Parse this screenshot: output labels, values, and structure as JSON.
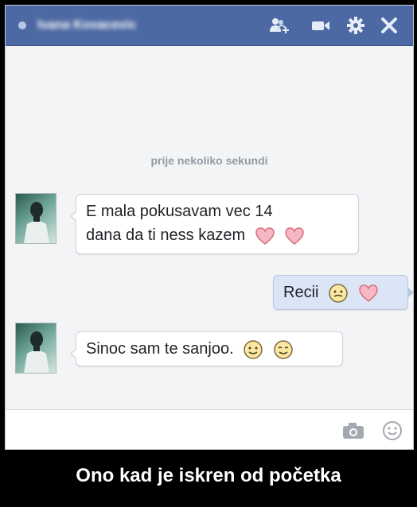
{
  "chat_header": {
    "contact_name": "Ivana Kovacevic",
    "status_color": "#b8c7e4",
    "bar_color": "#4d69a3",
    "icons": [
      "add-friend-icon",
      "video-camera-icon",
      "gear-icon",
      "close-icon"
    ]
  },
  "conversation": {
    "timestamp": "prije nekoliko sekundi",
    "messages": [
      {
        "sender": "contact",
        "lines": [
          "E mala pokusavam vec 14",
          "dana da ti ness kazem"
        ],
        "emojis": [
          "heart-icon",
          "heart-icon"
        ]
      },
      {
        "sender": "self",
        "text": "Recii",
        "emojis": [
          "smiley-face-icon",
          "heart-icon"
        ]
      },
      {
        "sender": "contact",
        "text": "Sinoc sam te sanjoo.",
        "emojis": [
          "smiley-face-icon",
          "smiley-face-icon"
        ]
      }
    ]
  },
  "composer": {
    "input_value": "",
    "icons": [
      "camera-icon",
      "emoji-icon"
    ]
  },
  "caption": "Ono kad je iskren od početka"
}
